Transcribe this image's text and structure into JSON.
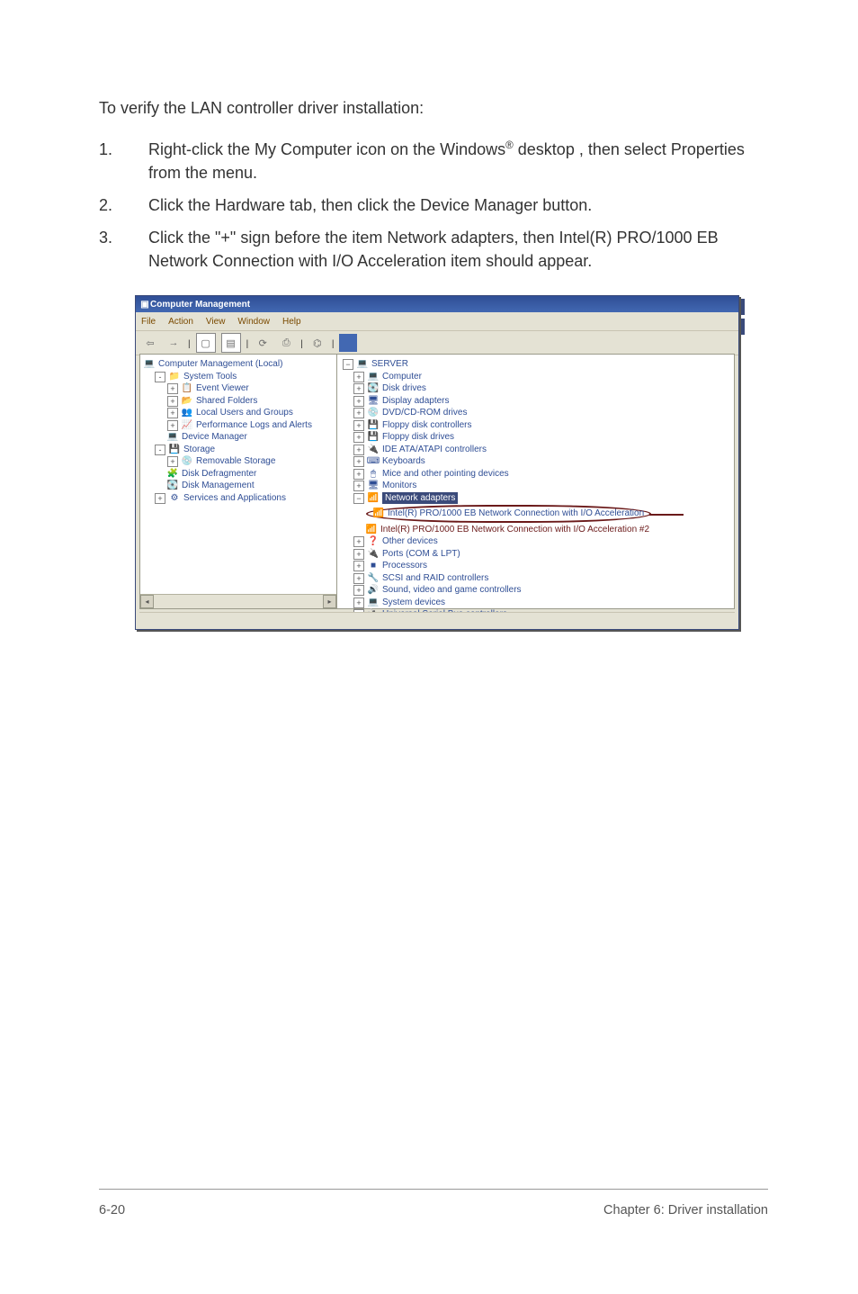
{
  "intro": "To verify the LAN controller driver installation:",
  "steps": [
    {
      "num": "1.",
      "html": "Right-click the My Computer icon on the Windows<sup>®</sup> desktop , then select Properties from the menu."
    },
    {
      "num": "2.",
      "html": "Click the Hardware tab, then click the Device Manager button."
    },
    {
      "num": "3.",
      "html": "Click the \"+\" sign before the item Network adapters, then Intel(R) PRO/1000 EB Network Connection with I/O Acceleration item should appear."
    }
  ],
  "window": {
    "title": "Computer Management",
    "menu": [
      "File",
      "Action",
      "View",
      "Window",
      "Help"
    ]
  },
  "left_tree": {
    "root": "Computer Management (Local)",
    "items": [
      {
        "indent": 1,
        "pm": "-",
        "icon": "📁",
        "label": "System Tools"
      },
      {
        "indent": 2,
        "pm": "+",
        "icon": "📋",
        "label": "Event Viewer"
      },
      {
        "indent": 2,
        "pm": "+",
        "icon": "📂",
        "label": "Shared Folders"
      },
      {
        "indent": 2,
        "pm": "+",
        "icon": "👥",
        "label": "Local Users and Groups"
      },
      {
        "indent": 2,
        "pm": "+",
        "icon": "📈",
        "label": "Performance Logs and Alerts"
      },
      {
        "indent": 2,
        "pm": "",
        "icon": "💻",
        "label": "Device Manager"
      },
      {
        "indent": 1,
        "pm": "-",
        "icon": "💾",
        "label": "Storage"
      },
      {
        "indent": 2,
        "pm": "+",
        "icon": "💿",
        "label": "Removable Storage"
      },
      {
        "indent": 2,
        "pm": "",
        "icon": "🧩",
        "label": "Disk Defragmenter"
      },
      {
        "indent": 2,
        "pm": "",
        "icon": "💽",
        "label": "Disk Management"
      },
      {
        "indent": 1,
        "pm": "+",
        "icon": "⚙",
        "label": "Services and Applications"
      }
    ]
  },
  "right_tree": {
    "root": "SERVER",
    "items": [
      {
        "pm": "+",
        "icon": "💻",
        "label": "Computer"
      },
      {
        "pm": "+",
        "icon": "💽",
        "label": "Disk drives"
      },
      {
        "pm": "+",
        "icon": "🖥",
        "label": "Display adapters"
      },
      {
        "pm": "+",
        "icon": "💿",
        "label": "DVD/CD-ROM drives"
      },
      {
        "pm": "+",
        "icon": "💾",
        "label": "Floppy disk controllers"
      },
      {
        "pm": "+",
        "icon": "💾",
        "label": "Floppy disk drives"
      },
      {
        "pm": "+",
        "icon": "🔌",
        "label": "IDE ATA/ATAPI controllers"
      },
      {
        "pm": "+",
        "icon": "⌨",
        "label": "Keyboards"
      },
      {
        "pm": "+",
        "icon": "🖱",
        "label": "Mice and other pointing devices"
      },
      {
        "pm": "+",
        "icon": "🖥",
        "label": "Monitors"
      }
    ],
    "network": {
      "title": "Network adapters",
      "highlighted": "Intel(R) PRO/1000 EB Network Connection with I/O Acceleration",
      "second": "Intel(R) PRO/1000 EB Network Connection with I/O Acceleration #2"
    },
    "items2": [
      {
        "pm": "+",
        "icon": "❓",
        "label": "Other devices"
      },
      {
        "pm": "+",
        "icon": "🔌",
        "label": "Ports (COM & LPT)"
      },
      {
        "pm": "+",
        "icon": "■",
        "label": "Processors"
      },
      {
        "pm": "+",
        "icon": "🔧",
        "label": "SCSI and RAID controllers"
      },
      {
        "pm": "+",
        "icon": "🔊",
        "label": "Sound, video and game controllers"
      },
      {
        "pm": "+",
        "icon": "💻",
        "label": "System devices"
      },
      {
        "pm": "+",
        "icon": "🔌",
        "label": "Universal Serial Bus controllers"
      }
    ]
  },
  "footer": {
    "left": "6-20",
    "right": "Chapter 6: Driver installation"
  }
}
